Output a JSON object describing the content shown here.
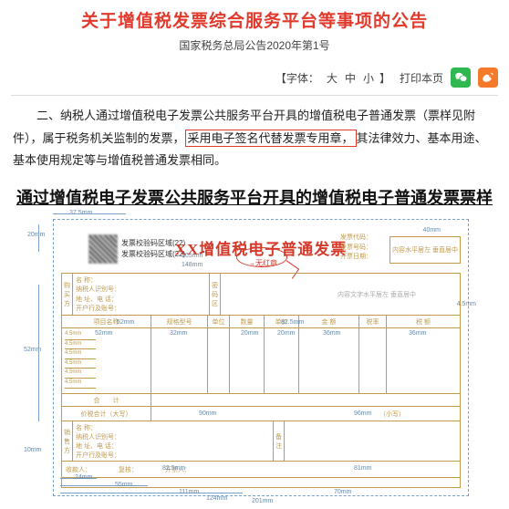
{
  "header": {
    "title": "关于增值税发票综合服务平台等事项的公告",
    "subtitle": "国家税务总局公告2020年第1号",
    "font_label": "【字体：",
    "font_big": "大",
    "font_mid": "中",
    "font_small": "小",
    "font_end": "】",
    "print_label": "打印本页"
  },
  "body": {
    "para_lead": "二、纳税人通过增值税电子发票公共服务平台开具的增值税电子普通发票（票样见附件），属于税务机关监制的发票，",
    "para_framed": "采用电子签名代替发票专用章，",
    "para_tail": "其法律效力、基本用途、基本使用规定等与增值税普通发票相同。"
  },
  "section_title": "通过增值税电子发票公共服务平台开具的增值税电子普通发票票样",
  "invoice": {
    "top_dim": "37.5mm",
    "left_dim_1": "20mm",
    "title": "XX增值税电子普通发票",
    "oval_note": "→无红章",
    "qr_label_1": "发票校验码区域(22)",
    "qr_label_2": "发票校验码区域(22)",
    "under_title_dim1": "105mm",
    "under_title_dim2": "148mm",
    "right_meta_1": "发票代码：",
    "right_meta_2": "发票号码：",
    "right_meta_3": "开票日期：",
    "metabox_label": "内容水平居左 垂直居中",
    "buyer_head": "购买方",
    "buyer_f1": "名 称：",
    "buyer_f2": "纳税人识别号：",
    "buyer_f3": "地 址、电 话：",
    "buyer_f4": "开户行及账号：",
    "buyer_dim": "52mm",
    "pwd_head": "密码区",
    "pwd_dim": "82.5mm",
    "pwd_note": "内容文字水平居左 垂直居中",
    "cols": {
      "c1": "项目名称",
      "c2": "规格型号",
      "c3": "单位",
      "c4": "数量",
      "c5": "单价",
      "c6": "金 额",
      "c7": "税率",
      "c8": "税 额"
    },
    "col_dims": {
      "d1": "52mm",
      "d2": "32mm",
      "d3": "",
      "d4": "20mm",
      "d5": "20mm",
      "d6": "36mm",
      "d7": "",
      "d8": "36mm"
    },
    "left_big_dim": "52mm",
    "stub_dims": [
      "4.5mm",
      "4.5mm",
      "4.5mm",
      "4.5mm",
      "4.5mm",
      "4.5mm"
    ],
    "sum_row_1": "合　　计",
    "sum_row_2a": "价税合计（大写）",
    "sum_row_2b": "（小写）",
    "sum_dim_a": "90mm",
    "sum_dim_b": "96mm",
    "seller_head": "销售方",
    "seller_f1": "名 称：",
    "seller_f2": "纳税人识别号：",
    "seller_f3": "地 址、电 话：",
    "seller_f4": "开户行及账号：",
    "remark_head": "备注",
    "seller_dim": "82.5mm",
    "seller_dim2": "81mm",
    "footer_f1": "收款人：",
    "footer_f2": "复核：",
    "footer_f3": "开票人：",
    "footer_dims": [
      "24mm",
      "55mm",
      "111mm",
      "124mm"
    ],
    "bottom_dims": [
      "70mm",
      "201mm"
    ],
    "side_dim": "10mm",
    "right_gap_dim": "4.5mm",
    "metabox_dim": "40mm"
  }
}
